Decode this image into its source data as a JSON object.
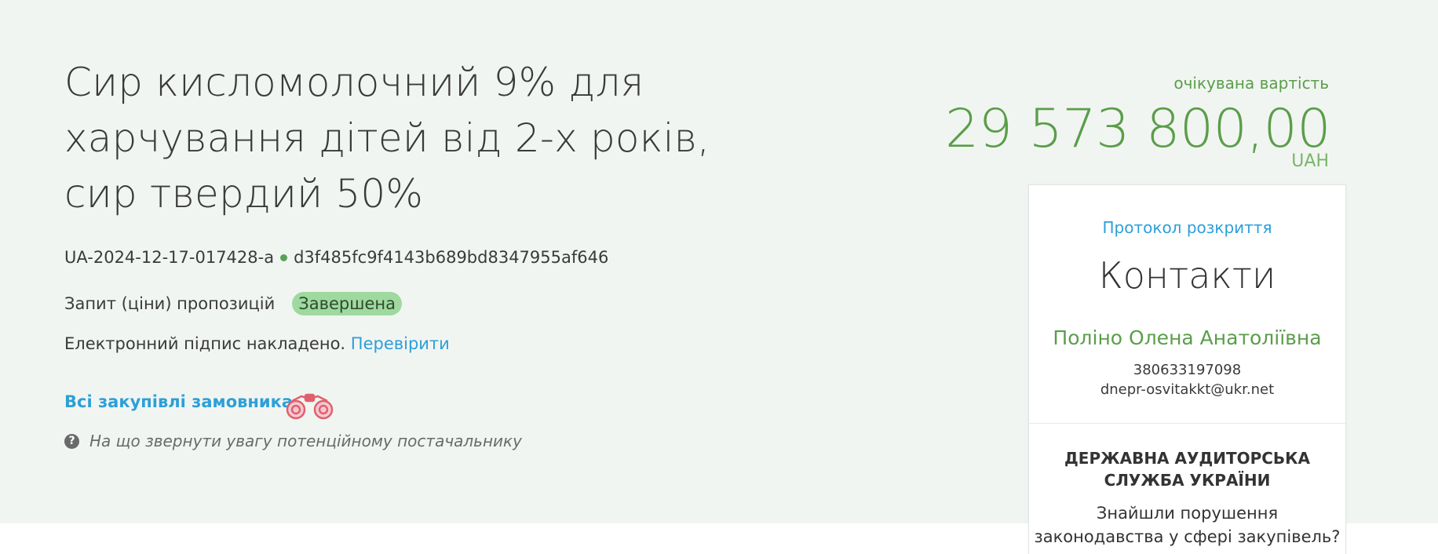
{
  "tender": {
    "title": "Сир кисломолочний 9% для харчування дітей від 2-х років, сир твердий 50%",
    "id": "UA-2024-12-17-017428-a",
    "hash": "d3f485fc9f4143b689bd8347955af646",
    "procedure_type": "Запит (ціни) пропозицій",
    "status": "Завершена",
    "signature_text": "Електронний підпис накладено.",
    "signature_check_link": "Перевірити",
    "all_purchases_link": "Всі закупівлі замовника",
    "hint_text": "На що звернути увагу потенційному постачальнику"
  },
  "price": {
    "label": "очікувана вартість",
    "amount": "29 573 800,00",
    "currency": "UAH"
  },
  "contacts_panel": {
    "protocol_link": "Протокол розкриття",
    "heading": "Контакти",
    "person_name": "Поліно Олена Анатоліївна",
    "phone": "380633197098",
    "email": "dnepr-osvitakkt@ukr.net",
    "audit_line1": "ДЕРЖАВНА АУДИТОРСЬКА",
    "audit_line2": "СЛУЖБА УКРАЇНИ",
    "question_line1": "Знайшли порушення",
    "question_line2": "законодавства у сфері закупівель?"
  },
  "icons": {
    "binoculars": "binoculars-icon",
    "help": "question-circle-icon"
  },
  "colors": {
    "hero_bg": "#f1f5f1",
    "accent_green": "#5a9e4a",
    "link_blue": "#2d9fd9",
    "status_badge": "#9fd99f",
    "binoculars": "#e0606e"
  }
}
